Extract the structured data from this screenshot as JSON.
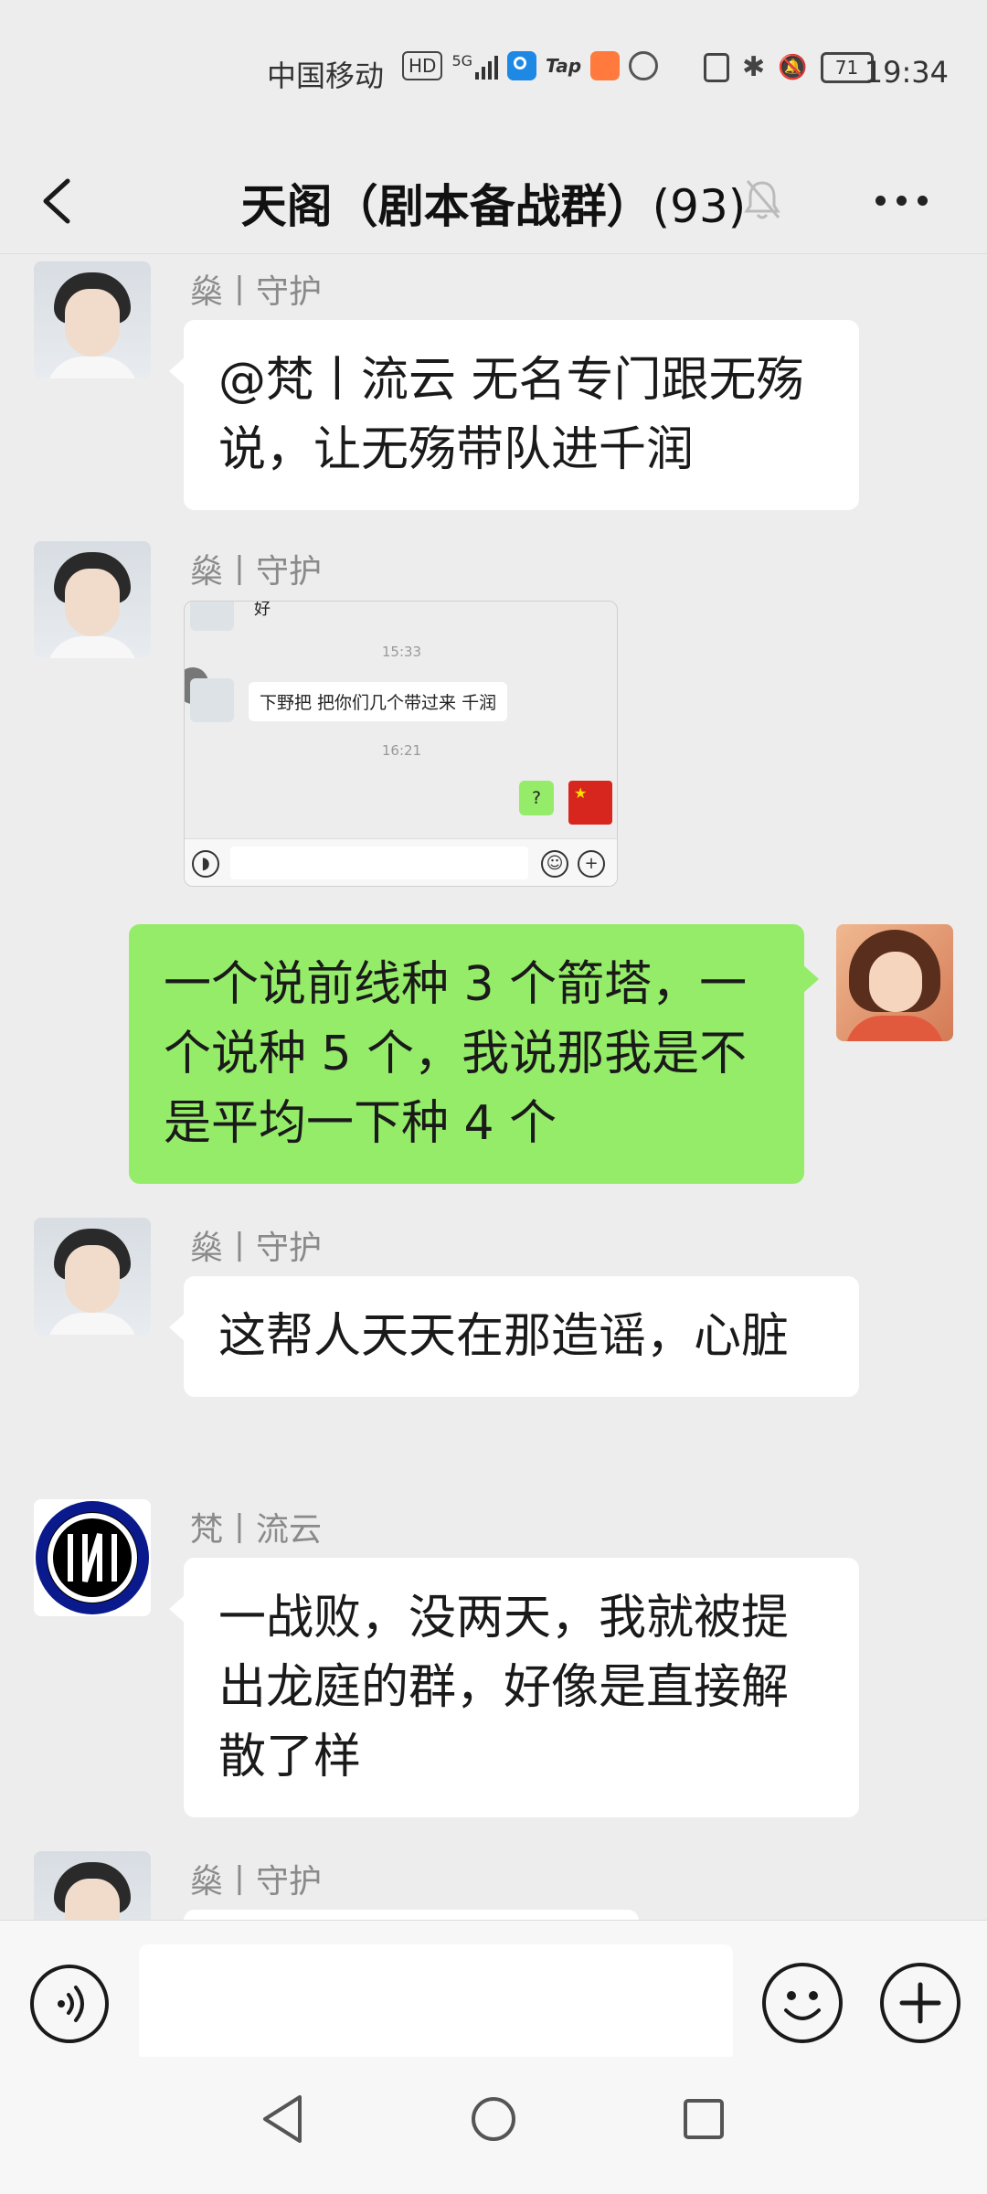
{
  "status": {
    "carrier": "中国移动",
    "hd": "HD",
    "network": "5G",
    "app1": "Tap",
    "battery": "71",
    "time": "19:34"
  },
  "header": {
    "title": "天阁（剧本备战群）",
    "count": "(93)"
  },
  "messages": [
    {
      "sender": "燊丨守护",
      "text": "@梵丨流云  无名专门跟无殇说，让无殇带队进千润"
    },
    {
      "sender": "燊丨守护",
      "image": {
        "partial_text": "好",
        "time1": "15:33",
        "bubble": "下野把  把你们几个带过来  千润",
        "time2": "16:21",
        "reply": "?"
      }
    },
    {
      "sender": "",
      "text": "一个说前线种 3 个箭塔，一个说种 5 个，我说那我是不是平均一下种 4 个"
    },
    {
      "sender": "燊丨守护",
      "text": "这帮人天天在那造谣，心脏"
    },
    {
      "sender": "梵丨流云",
      "text": "一战败，没两天，我就被提出龙庭的群，好像是直接解散了样"
    },
    {
      "sender": "燊丨守护",
      "text": ""
    }
  ],
  "icons": {
    "back": "chevron-left-icon",
    "mute": "bell-muted-icon",
    "more": "more-dots-icon",
    "voice": "voice-icon",
    "emoji": "emoji-icon",
    "plus": "plus-icon"
  },
  "colors": {
    "background": "#ededed",
    "outgoing_bubble": "#95ec69",
    "incoming_bubble": "#ffffff"
  }
}
